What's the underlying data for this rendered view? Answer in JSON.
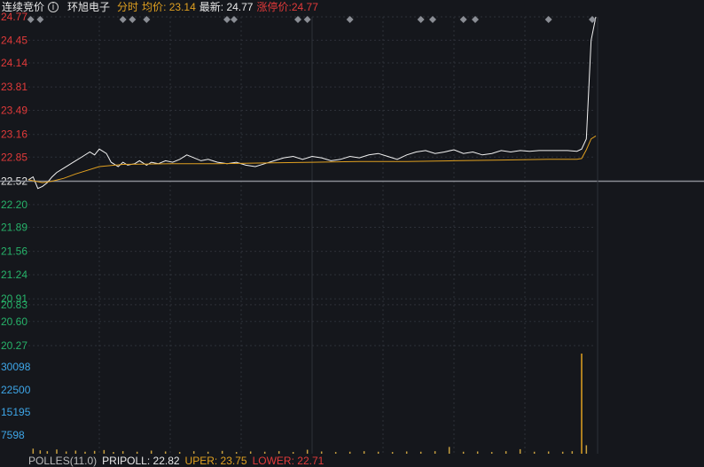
{
  "header": {
    "phase": "连续竞价",
    "info_glyph": "i",
    "stock_name": "环旭电子",
    "tab": "分时",
    "avg_label": "均价",
    "avg_value": "23.14",
    "last_label": "最新",
    "last_value": "24.77",
    "limit_label": "涨停价",
    "limit_value": "24.77"
  },
  "colors": {
    "up": "#e23a3a",
    "down": "#27b36a",
    "volume_axis": "#3ea6e8",
    "price_line": "#f2f2f2",
    "avg_line": "#e0a020",
    "grid": "#2d3038",
    "ref_line": "#8a8d94"
  },
  "indicators": [
    {
      "text": "POLLES(11.0)",
      "color": "#bbbbbb"
    },
    {
      "text": "PRIPOLL: 22.82",
      "color": "#e8e8e8"
    },
    {
      "text": "UPER: 23.75",
      "color": "#e0a020"
    },
    {
      "text": "LOWER: 22.71",
      "color": "#e23a3a"
    }
  ],
  "chart_data": {
    "type": "line",
    "y_ticks": [
      "24.77",
      "24.45",
      "24.14",
      "23.81",
      "23.49",
      "23.16",
      "22.85",
      "22.52",
      "22.20",
      "21.89",
      "21.56",
      "21.24",
      "20.91",
      "20.83",
      "20.60",
      "20.27"
    ],
    "reference_price": 22.52,
    "ylim": [
      20.27,
      24.77
    ],
    "volume_ticks": [
      "30098",
      "22500",
      "15195",
      "7598"
    ],
    "volume_ylim": [
      0,
      37700
    ],
    "minutes": 240,
    "series": [
      {
        "key": "price",
        "x": [
          0,
          2,
          4,
          6,
          8,
          10,
          12,
          15,
          18,
          20,
          23,
          26,
          28,
          30,
          33,
          35,
          38,
          40,
          42,
          45,
          47,
          50,
          52,
          55,
          58,
          61,
          64,
          67,
          70,
          73,
          76,
          80,
          84,
          88,
          92,
          96,
          100,
          104,
          108,
          112,
          116,
          120,
          124,
          128,
          132,
          136,
          140,
          144,
          148,
          152,
          156,
          160,
          164,
          168,
          172,
          176,
          180,
          184,
          188,
          192,
          196,
          200,
          204,
          208,
          212,
          216,
          220,
          224,
          228,
          232,
          234,
          236,
          238,
          240
        ],
        "y": [
          22.54,
          22.58,
          22.42,
          22.45,
          22.5,
          22.58,
          22.64,
          22.7,
          22.76,
          22.8,
          22.86,
          22.92,
          22.88,
          22.96,
          22.9,
          22.78,
          22.72,
          22.78,
          22.74,
          22.76,
          22.8,
          22.74,
          22.78,
          22.76,
          22.8,
          22.78,
          22.82,
          22.88,
          22.84,
          22.8,
          22.82,
          22.78,
          22.76,
          22.78,
          22.74,
          22.72,
          22.76,
          22.8,
          22.84,
          22.86,
          22.82,
          22.86,
          22.84,
          22.8,
          22.82,
          22.86,
          22.84,
          22.88,
          22.9,
          22.86,
          22.82,
          22.88,
          22.92,
          22.94,
          22.9,
          22.92,
          22.95,
          22.9,
          22.92,
          22.88,
          22.9,
          22.94,
          22.92,
          22.94,
          22.93,
          22.94,
          22.94,
          22.94,
          22.94,
          22.93,
          22.96,
          23.1,
          24.45,
          24.77
        ]
      },
      {
        "key": "avg",
        "x": [
          0,
          3,
          6,
          10,
          15,
          20,
          30,
          40,
          60,
          80,
          100,
          120,
          140,
          160,
          180,
          200,
          220,
          232,
          234,
          236,
          238,
          240
        ],
        "y": [
          22.54,
          22.52,
          22.5,
          22.52,
          22.56,
          22.62,
          22.72,
          22.75,
          22.76,
          22.76,
          22.77,
          22.78,
          22.79,
          22.79,
          22.8,
          22.81,
          22.82,
          22.82,
          22.83,
          22.95,
          23.1,
          23.14
        ]
      }
    ],
    "volume": [
      {
        "x": 2,
        "v": 1800
      },
      {
        "x": 5,
        "v": 1200
      },
      {
        "x": 8,
        "v": 900
      },
      {
        "x": 12,
        "v": 1500
      },
      {
        "x": 16,
        "v": 800
      },
      {
        "x": 20,
        "v": 1100
      },
      {
        "x": 24,
        "v": 700
      },
      {
        "x": 28,
        "v": 1000
      },
      {
        "x": 32,
        "v": 1300
      },
      {
        "x": 36,
        "v": 600
      },
      {
        "x": 40,
        "v": 900
      },
      {
        "x": 46,
        "v": 700
      },
      {
        "x": 52,
        "v": 1100
      },
      {
        "x": 58,
        "v": 800
      },
      {
        "x": 64,
        "v": 600
      },
      {
        "x": 70,
        "v": 900
      },
      {
        "x": 76,
        "v": 700
      },
      {
        "x": 82,
        "v": 1000
      },
      {
        "x": 88,
        "v": 600
      },
      {
        "x": 94,
        "v": 800
      },
      {
        "x": 100,
        "v": 700
      },
      {
        "x": 106,
        "v": 900
      },
      {
        "x": 112,
        "v": 600
      },
      {
        "x": 118,
        "v": 1400
      },
      {
        "x": 124,
        "v": 800
      },
      {
        "x": 130,
        "v": 600
      },
      {
        "x": 136,
        "v": 700
      },
      {
        "x": 142,
        "v": 900
      },
      {
        "x": 148,
        "v": 700
      },
      {
        "x": 154,
        "v": 600
      },
      {
        "x": 160,
        "v": 800
      },
      {
        "x": 166,
        "v": 700
      },
      {
        "x": 172,
        "v": 900
      },
      {
        "x": 178,
        "v": 2400
      },
      {
        "x": 184,
        "v": 700
      },
      {
        "x": 190,
        "v": 800
      },
      {
        "x": 196,
        "v": 600
      },
      {
        "x": 202,
        "v": 900
      },
      {
        "x": 208,
        "v": 1600
      },
      {
        "x": 214,
        "v": 700
      },
      {
        "x": 220,
        "v": 800
      },
      {
        "x": 226,
        "v": 700
      },
      {
        "x": 230,
        "v": 900
      },
      {
        "x": 234,
        "v": 35500
      },
      {
        "x": 236,
        "v": 3000
      }
    ],
    "markers_x": [
      1,
      5,
      40,
      44,
      50,
      84,
      87,
      114,
      118,
      136,
      166,
      171,
      184,
      189,
      220
    ]
  }
}
